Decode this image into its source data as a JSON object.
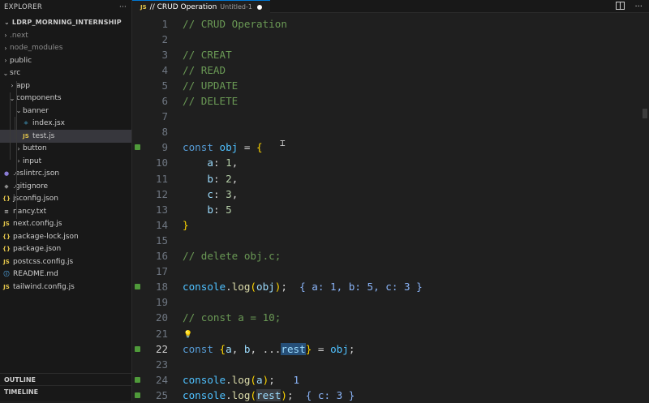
{
  "explorer": {
    "title": "EXPLORER",
    "more": "···",
    "project": "LDRP_MORNING_INTERNSHIP",
    "tree": [
      {
        "label": ".next",
        "type": "folder",
        "depth": 0,
        "open": false,
        "dim": true
      },
      {
        "label": "node_modules",
        "type": "folder",
        "depth": 0,
        "open": false,
        "dim": true
      },
      {
        "label": "public",
        "type": "folder",
        "depth": 0,
        "open": false
      },
      {
        "label": "src",
        "type": "folder",
        "depth": 0,
        "open": true
      },
      {
        "label": "app",
        "type": "folder",
        "depth": 1,
        "open": false
      },
      {
        "label": "components",
        "type": "folder",
        "depth": 1,
        "open": true
      },
      {
        "label": "banner",
        "type": "folder",
        "depth": 2,
        "open": true
      },
      {
        "label": "index.jsx",
        "type": "jsx",
        "depth": 3
      },
      {
        "label": "test.js",
        "type": "js",
        "depth": 3,
        "selected": true
      },
      {
        "label": "button",
        "type": "folder",
        "depth": 2,
        "open": false
      },
      {
        "label": "input",
        "type": "folder",
        "depth": 2,
        "open": false
      },
      {
        "label": ".eslintrc.json",
        "type": "eslint",
        "depth": 0
      },
      {
        "label": ".gitignore",
        "type": "git",
        "depth": 0
      },
      {
        "label": "jsconfig.json",
        "type": "json",
        "depth": 0
      },
      {
        "label": "nancy.txt",
        "type": "txt",
        "depth": 0
      },
      {
        "label": "next.config.js",
        "type": "js",
        "depth": 0
      },
      {
        "label": "package-lock.json",
        "type": "json",
        "depth": 0
      },
      {
        "label": "package.json",
        "type": "json",
        "depth": 0
      },
      {
        "label": "postcss.config.js",
        "type": "js",
        "depth": 0
      },
      {
        "label": "README.md",
        "type": "md",
        "depth": 0
      },
      {
        "label": "tailwind.config.js",
        "type": "js",
        "depth": 0
      }
    ],
    "outline": "OUTLINE",
    "timeline": "TIMELINE"
  },
  "tab": {
    "icon": "JS",
    "title": "// CRUD Operation",
    "description": "Untitled-1"
  },
  "editor": {
    "current_line": 22,
    "lines": [
      {
        "n": 1,
        "t": [
          [
            "cm",
            "// CRUD Operation"
          ]
        ]
      },
      {
        "n": 2,
        "t": []
      },
      {
        "n": 3,
        "t": [
          [
            "cm",
            "// CREAT"
          ]
        ]
      },
      {
        "n": 4,
        "t": [
          [
            "cm",
            "// READ"
          ]
        ]
      },
      {
        "n": 5,
        "t": [
          [
            "cm",
            "// UPDATE"
          ]
        ]
      },
      {
        "n": 6,
        "t": [
          [
            "cm",
            "// DELETE"
          ]
        ]
      },
      {
        "n": 7,
        "t": []
      },
      {
        "n": 8,
        "t": []
      },
      {
        "n": 9,
        "mark": true,
        "t": [
          [
            "kw",
            "const "
          ],
          [
            "vr",
            "obj"
          ],
          [
            "op",
            " = "
          ],
          [
            "br1",
            "{"
          ]
        ]
      },
      {
        "n": 10,
        "t": [
          [
            "op",
            "    "
          ],
          [
            "pr",
            "a"
          ],
          [
            "op",
            ": "
          ],
          [
            "nm",
            "1"
          ],
          [
            "op",
            ","
          ]
        ]
      },
      {
        "n": 11,
        "t": [
          [
            "op",
            "    "
          ],
          [
            "pr",
            "b"
          ],
          [
            "op",
            ": "
          ],
          [
            "nm",
            "2"
          ],
          [
            "op",
            ","
          ]
        ]
      },
      {
        "n": 12,
        "t": [
          [
            "op",
            "    "
          ],
          [
            "pr",
            "c"
          ],
          [
            "op",
            ": "
          ],
          [
            "nm",
            "3"
          ],
          [
            "op",
            ","
          ]
        ]
      },
      {
        "n": 13,
        "t": [
          [
            "op",
            "    "
          ],
          [
            "pr",
            "b"
          ],
          [
            "op",
            ": "
          ],
          [
            "nm",
            "5"
          ]
        ]
      },
      {
        "n": 14,
        "t": [
          [
            "br1",
            "}"
          ]
        ]
      },
      {
        "n": 15,
        "t": []
      },
      {
        "n": 16,
        "t": [
          [
            "cm",
            "// delete obj.c;"
          ]
        ]
      },
      {
        "n": 17,
        "t": []
      },
      {
        "n": 18,
        "mark": true,
        "t": [
          [
            "vr",
            "console"
          ],
          [
            "op",
            "."
          ],
          [
            "fn",
            "log"
          ],
          [
            "br1",
            "("
          ],
          [
            "pr",
            "obj"
          ],
          [
            "br1",
            ")"
          ],
          [
            "op",
            ";  "
          ],
          [
            "hint",
            "{ a: 1, b: 5, c: 3 }"
          ]
        ]
      },
      {
        "n": 19,
        "t": []
      },
      {
        "n": 20,
        "t": [
          [
            "cm",
            "// const a = 10;"
          ]
        ]
      },
      {
        "n": 21,
        "t": []
      },
      {
        "n": 22,
        "mark": true,
        "t": [
          [
            "kw",
            "const "
          ],
          [
            "br1",
            "{"
          ],
          [
            "pr",
            "a"
          ],
          [
            "op",
            ", "
          ],
          [
            "pr",
            "b"
          ],
          [
            "op",
            ", ..."
          ],
          [
            "pr hl-sel",
            "rest"
          ],
          [
            "br1",
            "}"
          ],
          [
            "op",
            " = "
          ],
          [
            "vr",
            "obj"
          ],
          [
            "op",
            ";"
          ]
        ]
      },
      {
        "n": 23,
        "t": []
      },
      {
        "n": 24,
        "mark": true,
        "t": [
          [
            "vr",
            "console"
          ],
          [
            "op",
            "."
          ],
          [
            "fn",
            "log"
          ],
          [
            "br1",
            "("
          ],
          [
            "pr",
            "a"
          ],
          [
            "br1",
            ")"
          ],
          [
            "op",
            ";   "
          ],
          [
            "hint",
            "1"
          ]
        ]
      },
      {
        "n": 25,
        "mark": true,
        "t": [
          [
            "vr",
            "console"
          ],
          [
            "op",
            "."
          ],
          [
            "fn",
            "log"
          ],
          [
            "br1",
            "("
          ],
          [
            "pr hl-word",
            "rest"
          ],
          [
            "br1",
            ")"
          ],
          [
            "op",
            ";  "
          ],
          [
            "hint",
            "{ c: 3 }"
          ]
        ]
      }
    ]
  },
  "icons": {
    "split": "split-editor-icon",
    "more": "more-actions-icon",
    "bulb": "lightbulb-icon"
  }
}
